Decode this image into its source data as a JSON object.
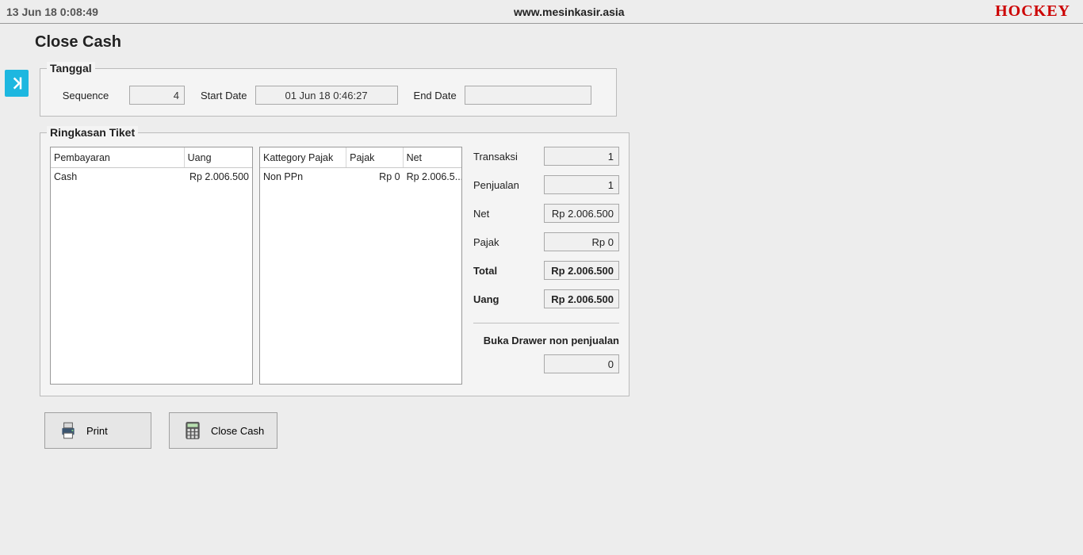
{
  "topbar": {
    "datetime": "13 Jun 18  0:08:49",
    "url": "www.mesinkasir.asia",
    "brand": "HOCKEY"
  },
  "page_title": "Close Cash",
  "tanggal": {
    "legend": "Tanggal",
    "sequence_label": "Sequence",
    "sequence_value": "4",
    "start_label": "Start Date",
    "start_value": "01 Jun 18 0:46:27",
    "end_label": "End Date",
    "end_value": ""
  },
  "ringkasan": {
    "legend": "Ringkasan Tiket",
    "payment_table": {
      "headers": {
        "c1": "Pembayaran",
        "c2": "Uang"
      },
      "rows": [
        {
          "c1": "Cash",
          "c2": "Rp 2.006.500"
        }
      ]
    },
    "tax_table": {
      "headers": {
        "c1": "Kattegory Pajak",
        "c2": "Pajak",
        "c3": "Net"
      },
      "rows": [
        {
          "c1": "Non PPn",
          "c2": "Rp 0",
          "c3": "Rp 2.006.5..."
        }
      ]
    },
    "summary": {
      "transaksi_label": "Transaksi",
      "transaksi_value": "1",
      "penjualan_label": "Penjualan",
      "penjualan_value": "1",
      "net_label": "Net",
      "net_value": "Rp 2.006.500",
      "pajak_label": "Pajak",
      "pajak_value": "Rp 0",
      "total_label": "Total",
      "total_value": "Rp 2.006.500",
      "uang_label": "Uang",
      "uang_value": "Rp 2.006.500",
      "drawer_label": "Buka Drawer non penjualan",
      "drawer_value": "0"
    }
  },
  "buttons": {
    "print": "Print",
    "close_cash": "Close Cash"
  }
}
